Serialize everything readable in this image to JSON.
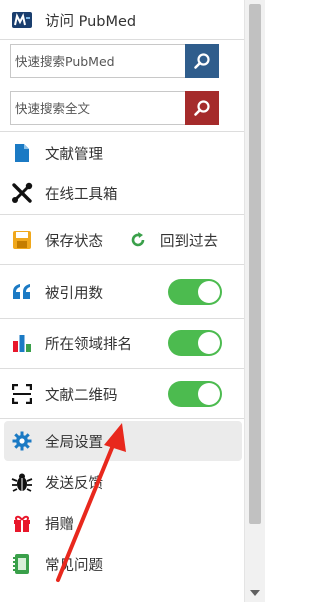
{
  "header": {
    "pubmed_label": "访问 PubMed"
  },
  "search": {
    "pubmed_placeholder": "快速搜索PubMed",
    "fulltext_placeholder": "快速搜索全文"
  },
  "menu": {
    "docs": "文献管理",
    "tools": "在线工具箱",
    "save_state": "保存状态",
    "restore": "回到过去",
    "citations": "被引用数",
    "field_rank": "所在领域排名",
    "qrcode": "文献二维码",
    "settings": "全局设置",
    "feedback": "发送反馈",
    "donate": "捐赠",
    "faq": "常见问题"
  },
  "toggles": {
    "citations": true,
    "field_rank": true,
    "qrcode": true
  },
  "colors": {
    "search_blue": "#2f5d8c",
    "search_red": "#a52b2b",
    "toggle_green": "#4cbb4f",
    "icon_blue": "#1b7ac4",
    "icon_orange": "#f0a81c",
    "icon_green": "#3aa04a",
    "icon_red": "#e8172b",
    "arrow_red": "#e8281d"
  }
}
